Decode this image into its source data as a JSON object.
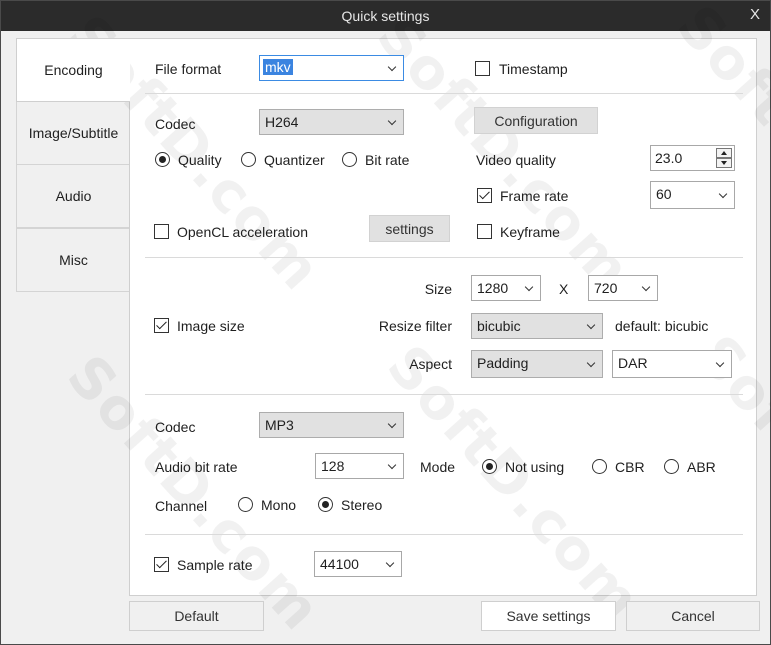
{
  "window": {
    "title": "Quick settings",
    "close_label": "X"
  },
  "tabs": [
    "Encoding",
    "Image/Subtitle",
    "Audio",
    "Misc"
  ],
  "general": {
    "file_format_label": "File format",
    "file_format_value": "mkv",
    "timestamp_label": "Timestamp",
    "timestamp_checked": false
  },
  "video": {
    "codec_label": "Codec",
    "codec_value": "H264",
    "configuration_button": "Configuration",
    "mode_options": [
      "Quality",
      "Quantizer",
      "Bit rate"
    ],
    "mode_selected": "Quality",
    "video_quality_label": "Video quality",
    "video_quality_value": "23.0",
    "frame_rate_label": "Frame rate",
    "frame_rate_checked": true,
    "frame_rate_value": "60",
    "opencl_label": "OpenCL acceleration",
    "opencl_checked": false,
    "settings_button": "settings",
    "keyframe_label": "Keyframe",
    "keyframe_checked": false
  },
  "image": {
    "size_label": "Size",
    "width_value": "1280",
    "x_label": "X",
    "height_value": "720",
    "image_size_label": "Image size",
    "image_size_checked": true,
    "resize_filter_label": "Resize filter",
    "resize_filter_value": "bicubic",
    "resize_filter_default": "default: bicubic",
    "aspect_label": "Aspect",
    "aspect_value": "Padding",
    "aspect_mode_value": "DAR"
  },
  "audio": {
    "codec_label": "Codec",
    "codec_value": "MP3",
    "bitrate_label": "Audio bit rate",
    "bitrate_value": "128",
    "mode_label": "Mode",
    "mode_options": [
      "Not using",
      "CBR",
      "ABR"
    ],
    "mode_selected": "Not using",
    "channel_label": "Channel",
    "channel_options": [
      "Mono",
      "Stereo"
    ],
    "channel_selected": "Stereo",
    "sample_rate_label": "Sample rate",
    "sample_rate_checked": true,
    "sample_rate_value": "44100"
  },
  "footer": {
    "default_button": "Default",
    "save_button": "Save settings",
    "cancel_button": "Cancel"
  },
  "watermark": "SoftD.com",
  "colors": {
    "titlebar": "#2b2b2b",
    "selection": "#3b84e0",
    "focus_border": "#3b8be3"
  }
}
